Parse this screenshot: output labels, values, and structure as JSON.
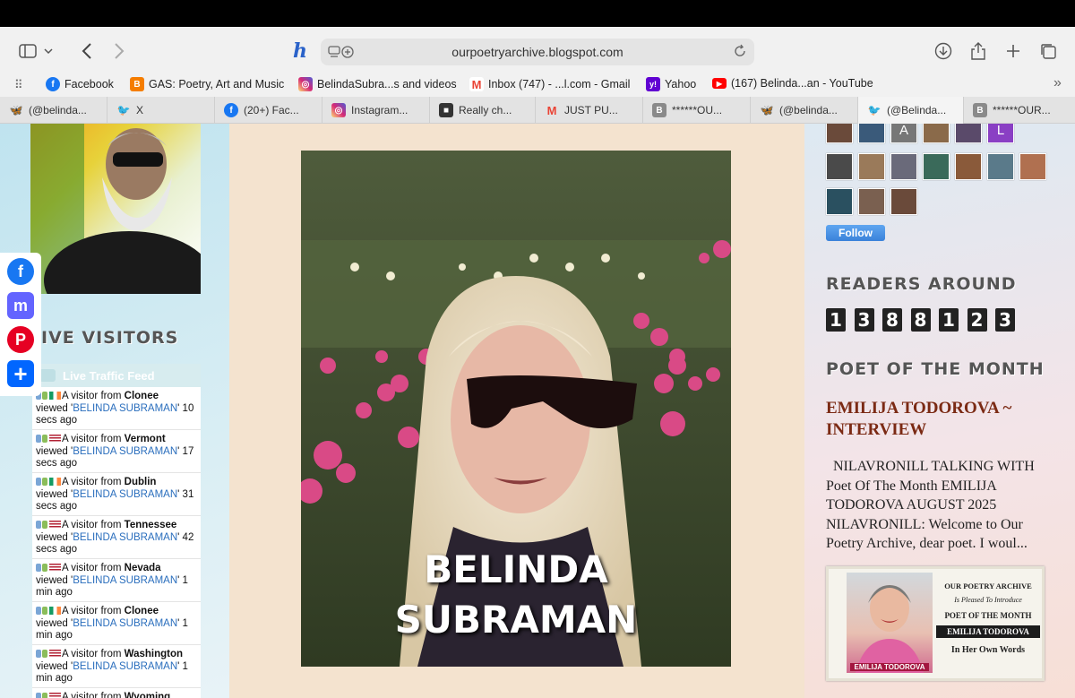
{
  "browser": {
    "url": "ourpoetryarchive.blogspot.com",
    "bookmarks": [
      {
        "label": "Facebook",
        "color": "#1877f2",
        "glyph": "f"
      },
      {
        "label": "GAS: Poetry, Art and Music",
        "color": "#f57d00",
        "glyph": "B"
      },
      {
        "label": "BelindaSubra...s and videos",
        "color": "#d6249f",
        "glyph": "◎"
      },
      {
        "label": "Inbox (747) - ...l.com - Gmail",
        "color": "#ea4335",
        "glyph": "M"
      },
      {
        "label": "Yahoo",
        "color": "#6001d2",
        "glyph": "y!"
      },
      {
        "label": "(167) Belinda...an - YouTube",
        "color": "#ff0000",
        "glyph": "▶"
      }
    ],
    "tabs": [
      {
        "label": "(@belinda...",
        "color": "#1185fe",
        "glyph": "🦋"
      },
      {
        "label": "X",
        "color": "#1da1f2",
        "glyph": "🐦"
      },
      {
        "label": "(20+) Fac...",
        "color": "#1877f2",
        "glyph": "f"
      },
      {
        "label": "Instagram...",
        "color": "#d6249f",
        "glyph": "◎"
      },
      {
        "label": "Really ch...",
        "color": "#333333",
        "glyph": "■"
      },
      {
        "label": "JUST PU...",
        "color": "#ea4335",
        "glyph": "M"
      },
      {
        "label": "******OU...",
        "color": "#8a8a8a",
        "glyph": "B"
      },
      {
        "label": "(@belinda...",
        "color": "#1185fe",
        "glyph": "🦋"
      },
      {
        "label": "(@Belinda...",
        "color": "#1da1f2",
        "glyph": "🐦"
      },
      {
        "label": "******OUR...",
        "color": "#8a8a8a",
        "glyph": "B"
      }
    ]
  },
  "left": {
    "live_visitors_title": "IVE VISITORS",
    "traffic_feed_title": "Live Traffic Feed",
    "visits": [
      {
        "flag": "ie",
        "place": "Clonee",
        "page": "BELINDA SUBRAMAN",
        "time": "10 secs ago"
      },
      {
        "flag": "us",
        "place": "Vermont",
        "page": "BELINDA SUBRAMAN",
        "time": "17 secs ago"
      },
      {
        "flag": "ie",
        "place": "Dublin",
        "page": "BELINDA SUBRAMAN",
        "time": "31 secs ago"
      },
      {
        "flag": "us",
        "place": "Tennessee",
        "page": "BELINDA SUBRAMAN",
        "time": "42 secs ago"
      },
      {
        "flag": "us",
        "place": "Nevada",
        "page": "BELINDA SUBRAMAN",
        "time": "1 min ago"
      },
      {
        "flag": "ie",
        "place": "Clonee",
        "page": "BELINDA SUBRAMAN",
        "time": "1 min ago"
      },
      {
        "flag": "us",
        "place": "Washington",
        "page": "BELINDA SUBRAMAN",
        "time": "1 min ago"
      },
      {
        "flag": "us",
        "place": "Wyoming",
        "page": "",
        "time": ""
      }
    ],
    "visit_prefix": "A visitor from",
    "visit_viewed": "viewed"
  },
  "main": {
    "caption_line1": "BELINDA",
    "caption_line2": "SUBRAMAN"
  },
  "right": {
    "avatar_letters": [
      "A",
      "L"
    ],
    "follow_label": "Follow",
    "readers_title": "READERS AROUND",
    "reader_digits": [
      "1",
      "3",
      "8",
      "8",
      "1",
      "2",
      "3"
    ],
    "potm_title": "POET OF THE MONTH",
    "potm_heading": "EMILIJA TODOROVA ~ INTERVIEW",
    "potm_excerpt": "NILAVRONILL TALKING WITH Poet Of The Month EMILIJA TODOROVA AUGUST 2025 NILAVRONILL: Welcome to Our Poetry Archive, dear poet. I woul...",
    "banner": {
      "line1": "OUR POETRY ARCHIVE",
      "line2": "Is Pleased To Introduce",
      "line3": "POET OF THE MONTH",
      "line4": "EMILIJA TODOROVA",
      "line5": "In Her Own Words",
      "caption": "EMILIJA TODOROVA"
    }
  }
}
